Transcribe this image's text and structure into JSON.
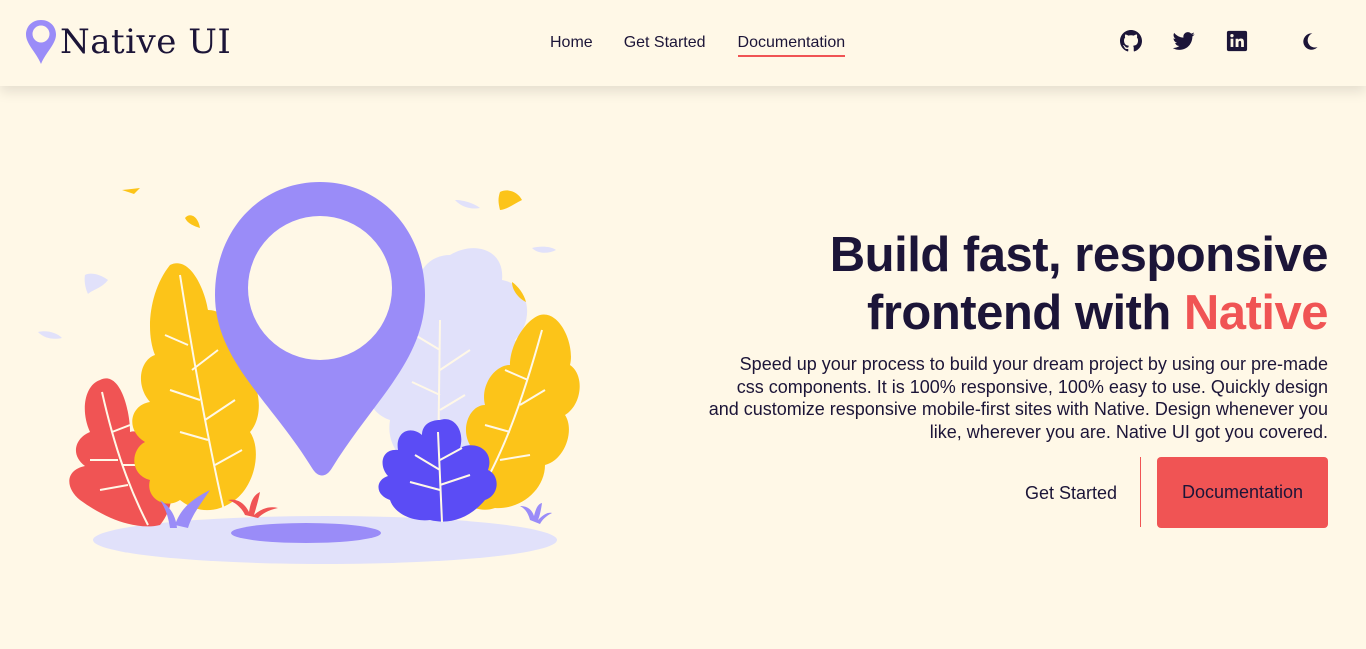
{
  "brand": {
    "name": "Native UI",
    "logo_icon": "map-pin-icon"
  },
  "nav": {
    "items": [
      {
        "label": "Home",
        "active": false
      },
      {
        "label": "Get Started",
        "active": false
      },
      {
        "label": "Documentation",
        "active": true
      }
    ]
  },
  "social": [
    {
      "icon": "github-icon"
    },
    {
      "icon": "twitter-icon"
    },
    {
      "icon": "linkedin-icon"
    }
  ],
  "theme_toggle": {
    "icon": "moon-icon"
  },
  "hero": {
    "title_line1": "Build fast, responsive",
    "title_line2_prefix": "frontend with ",
    "title_accent": "Native",
    "description": "Speed up your process to build your dream project by using our pre-made css components. It is 100% responsive, 100% easy to use. Quickly design and customize responsive mobile-first sites with Native. Design whenever you like, wherever you are. Native UI got you covered.",
    "cta_secondary": "Get Started",
    "cta_primary": "Documentation",
    "illustration": "location-pin-with-leaves-illustration"
  },
  "colors": {
    "background": "#fff8e7",
    "accent": "#f05454",
    "text": "#1c1538",
    "purple": "#9a8cf8",
    "yellow": "#fcc419"
  }
}
